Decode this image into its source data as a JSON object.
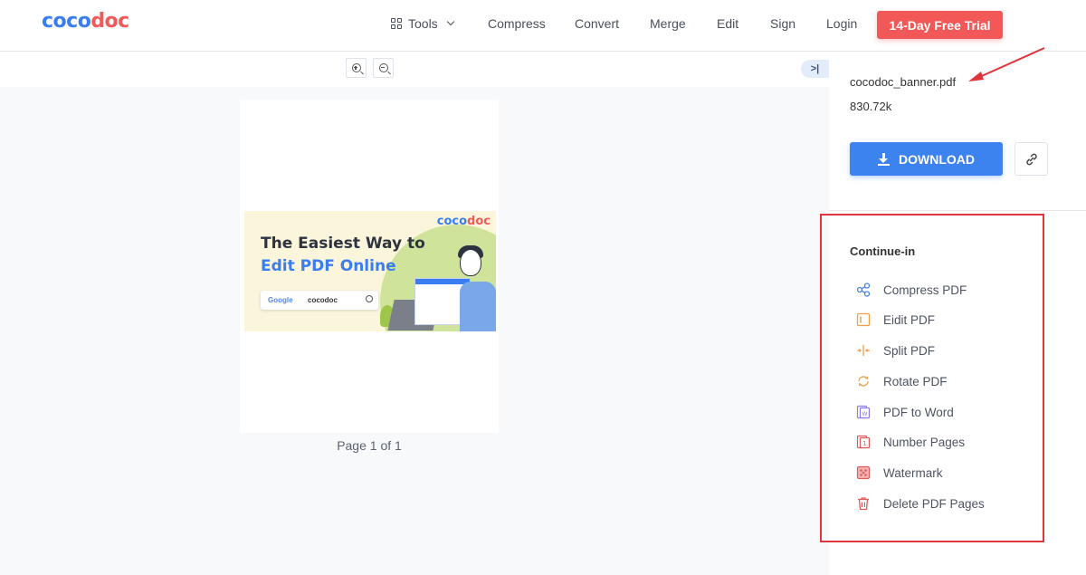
{
  "header": {
    "logo_part_a": "coco",
    "logo_part_b": "doc",
    "nav": {
      "tools": "Tools",
      "compress": "Compress",
      "convert": "Convert",
      "merge": "Merge",
      "edit": "Edit",
      "sign": "Sign",
      "login": "Login"
    },
    "trial_button": "14-Day Free Trial"
  },
  "viewer": {
    "collapse_label": ">|",
    "page_label": "Page 1 of 1",
    "banner": {
      "logo_a": "coco",
      "logo_b": "doc",
      "headline_1": "The Easiest Way to",
      "headline_2": "Edit PDF Online",
      "search_engine": "Google",
      "search_query": "cocodoc"
    }
  },
  "side": {
    "file_name": "cocodoc_banner.pdf",
    "file_size": "830.72k",
    "download_label": "DOWNLOAD",
    "continue_title": "Continue-in",
    "continue_items": [
      {
        "label": "Compress PDF",
        "icon": "share-nodes-icon",
        "color": "#4a7fe0"
      },
      {
        "label": "Eidit PDF",
        "icon": "edit-pdf-icon",
        "color": "#f0a04b"
      },
      {
        "label": "Split PDF",
        "icon": "split-icon",
        "color": "#f0a04b"
      },
      {
        "label": "Rotate PDF",
        "icon": "rotate-icon",
        "color": "#f0a04b"
      },
      {
        "label": "PDF to Word",
        "icon": "word-doc-icon",
        "color": "#8c7be8"
      },
      {
        "label": "Number Pages",
        "icon": "number-pages-icon",
        "color": "#e05a5a"
      },
      {
        "label": "Watermark",
        "icon": "watermark-icon",
        "color": "#e05a5a"
      },
      {
        "label": "Delete PDF Pages",
        "icon": "trash-icon",
        "color": "#e05a5a"
      }
    ]
  },
  "colors": {
    "brand_blue": "#3a7df0",
    "brand_red": "#f25a5a",
    "highlight_red": "#e0353c"
  }
}
